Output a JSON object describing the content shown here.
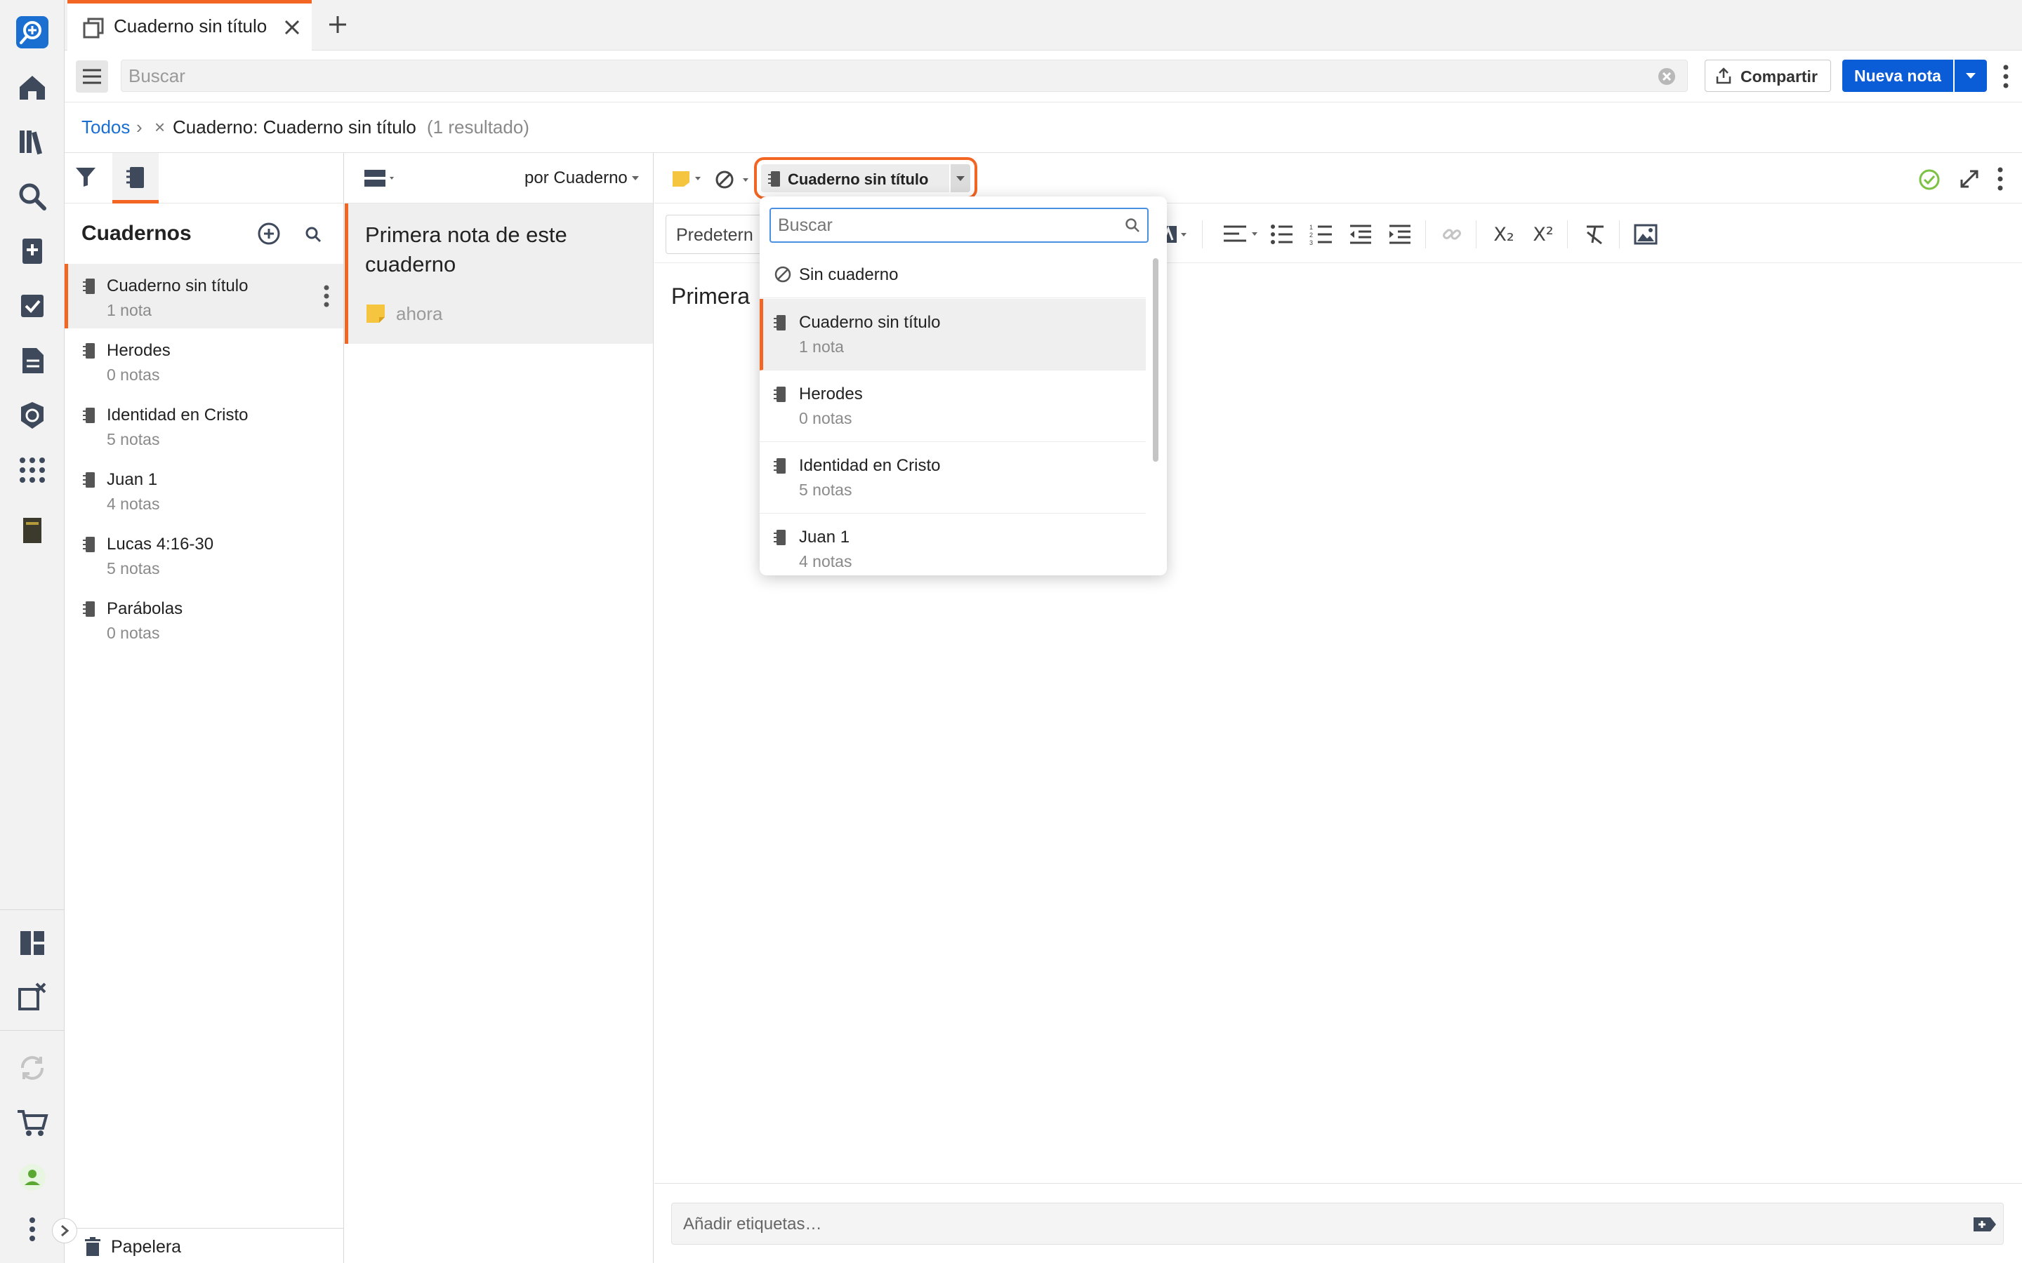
{
  "tab": {
    "title": "Cuaderno sin título"
  },
  "toolbar": {
    "search_placeholder": "Buscar",
    "share_label": "Compartir",
    "new_note_label": "Nueva nota"
  },
  "breadcrumb": {
    "all": "Todos",
    "separator": "›",
    "remove": "×",
    "filter": "Cuaderno: Cuaderno sin título",
    "count": "(1 resultado)"
  },
  "notebooks": {
    "title": "Cuadernos",
    "items": [
      {
        "name": "Cuaderno sin título",
        "count": "1 nota"
      },
      {
        "name": "Herodes",
        "count": "0 notas"
      },
      {
        "name": "Identidad en Cristo",
        "count": "5 notas"
      },
      {
        "name": "Juan 1",
        "count": "4 notas"
      },
      {
        "name": "Lucas 4:16-30",
        "count": "5 notas"
      },
      {
        "name": "Parábolas",
        "count": "0 notas"
      }
    ],
    "trash_label": "Papelera"
  },
  "notes": {
    "sort_label": "por Cuaderno",
    "items": [
      {
        "title": "Primera nota de este cuaderno",
        "time": "ahora"
      }
    ]
  },
  "editor": {
    "notebook_button": "Cuaderno sin título",
    "style_select": "Predetern",
    "body_preview": "Primera",
    "tags_placeholder": "Añadir etiquetas…"
  },
  "dropdown": {
    "search_placeholder": "Buscar",
    "no_notebook": "Sin cuaderno",
    "items": [
      {
        "name": "Cuaderno sin título",
        "count": "1 nota"
      },
      {
        "name": "Herodes",
        "count": "0 notas"
      },
      {
        "name": "Identidad en Cristo",
        "count": "5 notas"
      },
      {
        "name": "Juan 1",
        "count": "4 notas"
      }
    ]
  },
  "colors": {
    "accent": "#f26522",
    "primary": "#0b5cd7",
    "link": "#1a6fd1",
    "note_yellow": "#f5c540",
    "success": "#7cc242"
  }
}
